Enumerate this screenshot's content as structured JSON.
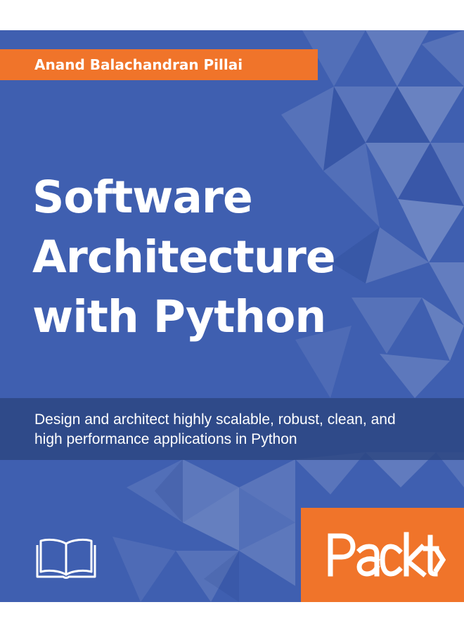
{
  "author": {
    "name": "Anand Balachandran Pillai"
  },
  "title": {
    "line1": "Software",
    "line2": "Architecture",
    "line3": "with Python"
  },
  "subtitle": {
    "line1": "Design and architect highly scalable, robust, clean, and",
    "line2": "high performance applications in Python"
  },
  "publisher": {
    "logo_text": "Packt>"
  },
  "icons": {
    "book": "open-book-icon"
  },
  "colors": {
    "background": "#3f5fb0",
    "accent_orange": "#f0742a",
    "subtitle_band": "#2c4680",
    "text": "#ffffff"
  }
}
